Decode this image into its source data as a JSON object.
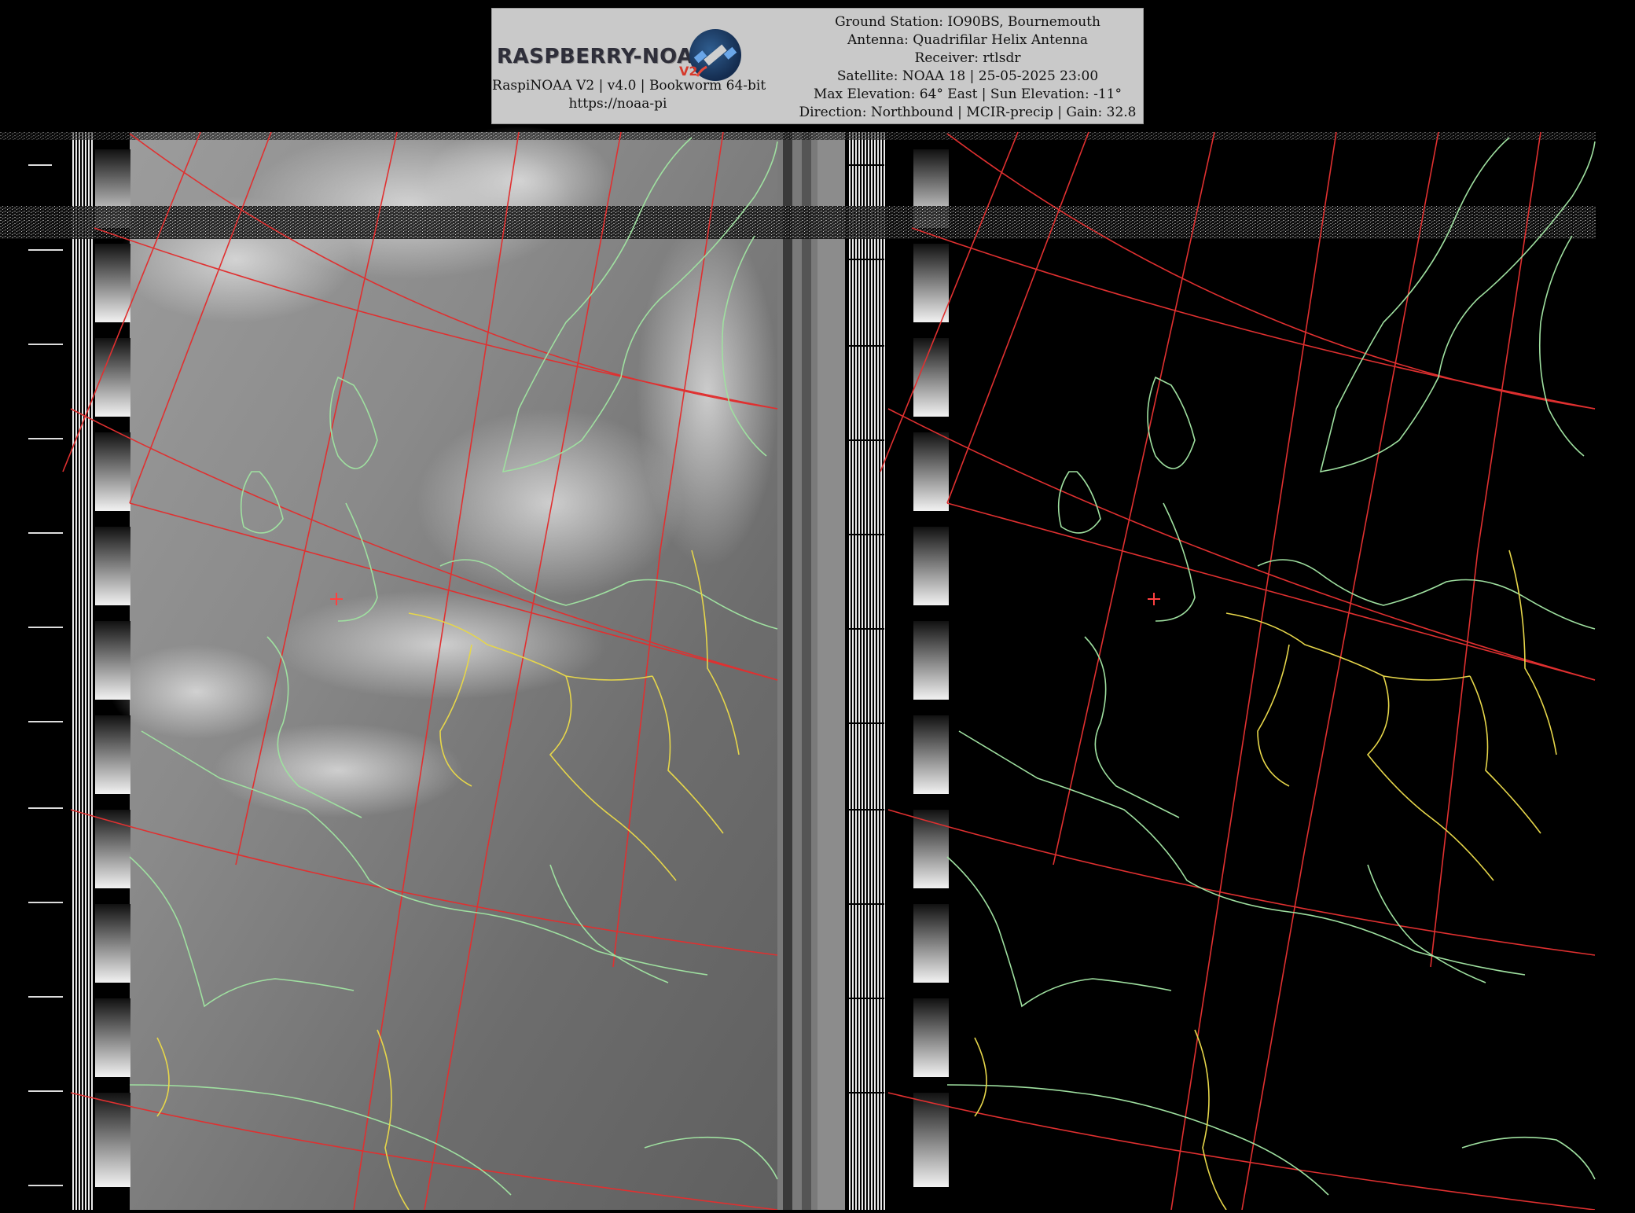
{
  "header": {
    "logo_text": "RASPBERRY-NOAA",
    "logo_version": "V2",
    "software_line": "RaspiNOAA V2 | v4.0 | Bookworm 64-bit",
    "website": "https://noaa-pi",
    "info_lines": [
      "Ground Station: IO90BS, Bournemouth",
      "Antenna: Quadrifilar Helix Antenna",
      "Receiver: rtlsdr",
      "Satellite: NOAA 18 | 25-05-2025 23:00",
      "Max Elevation: 64° East | Sun Elevation: -11°",
      "Direction: Northbound | MCIR-precip | Gain: 32.8"
    ]
  },
  "image": {
    "channel_a": "visible/IR cloud image (grayscale)",
    "channel_b": "infrared precipitation channel (black)",
    "colors": {
      "background": "#000000",
      "header_bg": "#c9c9c9",
      "coastline": "#9fe0a0",
      "borders": "#e6d64a",
      "grid": "#e03030",
      "station_marker": "#ff4040"
    }
  }
}
